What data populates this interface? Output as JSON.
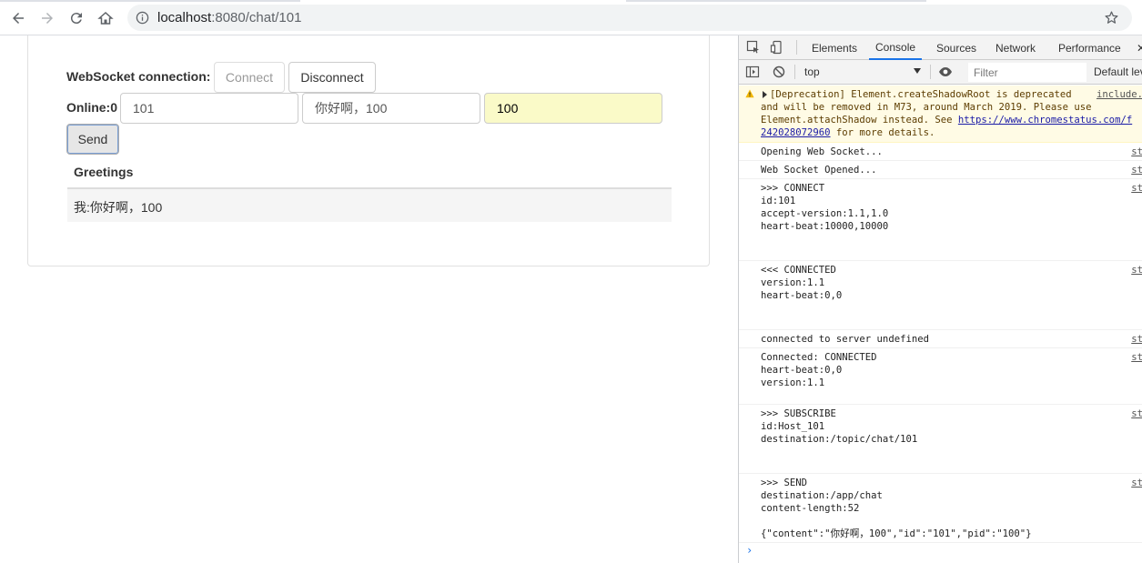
{
  "browser": {
    "url_host": "localhost",
    "url_path": ":8080/chat/101"
  },
  "page": {
    "ws_label": "WebSocket connection:",
    "connect_label": "Connect",
    "disconnect_label": "Disconnect",
    "online_label": "Online:0",
    "id_value": "101",
    "content_value": "你好啊，100",
    "pid_value": "100",
    "send_label": "Send",
    "table_header": "Greetings",
    "rows": [
      "我:你好啊，100"
    ]
  },
  "devtools": {
    "tabs": [
      "Elements",
      "Console",
      "Sources",
      "Network",
      "Performance"
    ],
    "selected_tab": "Console",
    "context": "top",
    "filter_placeholder": "Filter",
    "levels": "Default lev",
    "warning": {
      "line1": "[Deprecation] Element.createShadowRoot is deprecated",
      "line2": "and will be removed in M73, around March 2019. Please use",
      "line3": "Element.attachShadow instead. See ",
      "link1": "https://www.chromestatus.com/f",
      "link2": "242028072960",
      "tail": " for more details.",
      "source": "include."
    },
    "messages": [
      {
        "text": "Opening Web Socket...",
        "source": "st"
      },
      {
        "text": "Web Socket Opened...",
        "source": "st"
      },
      {
        "text": ">>> CONNECT\nid:101\naccept-version:1.1,1.0\nheart-beat:10000,10000",
        "source": "st"
      },
      {
        "text": "<<< CONNECTED\nversion:1.1\nheart-beat:0,0",
        "source": "st"
      },
      {
        "text": "connected to server undefined",
        "source": "st"
      },
      {
        "text": "Connected: CONNECTED\nheart-beat:0,0\nversion:1.1",
        "source": "st"
      },
      {
        "text": ">>> SUBSCRIBE\nid:Host_101\ndestination:/topic/chat/101",
        "source": "st"
      },
      {
        "text": ">>> SEND\ndestination:/app/chat\ncontent-length:52\n\n{\"content\":\"你好啊，100\",\"id\":\"101\",\"pid\":\"100\"}",
        "source": "st"
      }
    ],
    "prompt": "›"
  }
}
